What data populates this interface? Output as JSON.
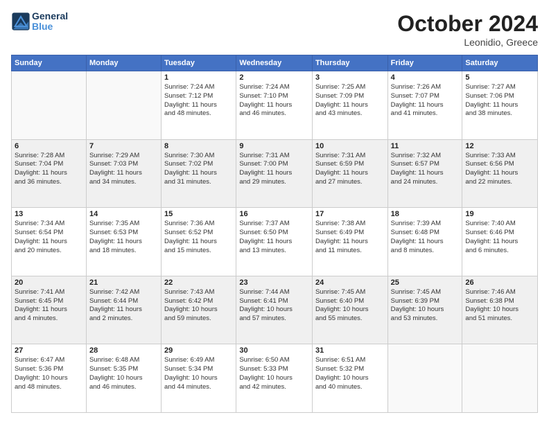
{
  "header": {
    "logo_general": "General",
    "logo_blue": "Blue",
    "month_title": "October 2024",
    "location": "Leonidio, Greece"
  },
  "days_of_week": [
    "Sunday",
    "Monday",
    "Tuesday",
    "Wednesday",
    "Thursday",
    "Friday",
    "Saturday"
  ],
  "weeks": [
    [
      {
        "day": "",
        "info": ""
      },
      {
        "day": "",
        "info": ""
      },
      {
        "day": "1",
        "info": "Sunrise: 7:24 AM\nSunset: 7:12 PM\nDaylight: 11 hours\nand 48 minutes."
      },
      {
        "day": "2",
        "info": "Sunrise: 7:24 AM\nSunset: 7:10 PM\nDaylight: 11 hours\nand 46 minutes."
      },
      {
        "day": "3",
        "info": "Sunrise: 7:25 AM\nSunset: 7:09 PM\nDaylight: 11 hours\nand 43 minutes."
      },
      {
        "day": "4",
        "info": "Sunrise: 7:26 AM\nSunset: 7:07 PM\nDaylight: 11 hours\nand 41 minutes."
      },
      {
        "day": "5",
        "info": "Sunrise: 7:27 AM\nSunset: 7:06 PM\nDaylight: 11 hours\nand 38 minutes."
      }
    ],
    [
      {
        "day": "6",
        "info": "Sunrise: 7:28 AM\nSunset: 7:04 PM\nDaylight: 11 hours\nand 36 minutes."
      },
      {
        "day": "7",
        "info": "Sunrise: 7:29 AM\nSunset: 7:03 PM\nDaylight: 11 hours\nand 34 minutes."
      },
      {
        "day": "8",
        "info": "Sunrise: 7:30 AM\nSunset: 7:02 PM\nDaylight: 11 hours\nand 31 minutes."
      },
      {
        "day": "9",
        "info": "Sunrise: 7:31 AM\nSunset: 7:00 PM\nDaylight: 11 hours\nand 29 minutes."
      },
      {
        "day": "10",
        "info": "Sunrise: 7:31 AM\nSunset: 6:59 PM\nDaylight: 11 hours\nand 27 minutes."
      },
      {
        "day": "11",
        "info": "Sunrise: 7:32 AM\nSunset: 6:57 PM\nDaylight: 11 hours\nand 24 minutes."
      },
      {
        "day": "12",
        "info": "Sunrise: 7:33 AM\nSunset: 6:56 PM\nDaylight: 11 hours\nand 22 minutes."
      }
    ],
    [
      {
        "day": "13",
        "info": "Sunrise: 7:34 AM\nSunset: 6:54 PM\nDaylight: 11 hours\nand 20 minutes."
      },
      {
        "day": "14",
        "info": "Sunrise: 7:35 AM\nSunset: 6:53 PM\nDaylight: 11 hours\nand 18 minutes."
      },
      {
        "day": "15",
        "info": "Sunrise: 7:36 AM\nSunset: 6:52 PM\nDaylight: 11 hours\nand 15 minutes."
      },
      {
        "day": "16",
        "info": "Sunrise: 7:37 AM\nSunset: 6:50 PM\nDaylight: 11 hours\nand 13 minutes."
      },
      {
        "day": "17",
        "info": "Sunrise: 7:38 AM\nSunset: 6:49 PM\nDaylight: 11 hours\nand 11 minutes."
      },
      {
        "day": "18",
        "info": "Sunrise: 7:39 AM\nSunset: 6:48 PM\nDaylight: 11 hours\nand 8 minutes."
      },
      {
        "day": "19",
        "info": "Sunrise: 7:40 AM\nSunset: 6:46 PM\nDaylight: 11 hours\nand 6 minutes."
      }
    ],
    [
      {
        "day": "20",
        "info": "Sunrise: 7:41 AM\nSunset: 6:45 PM\nDaylight: 11 hours\nand 4 minutes."
      },
      {
        "day": "21",
        "info": "Sunrise: 7:42 AM\nSunset: 6:44 PM\nDaylight: 11 hours\nand 2 minutes."
      },
      {
        "day": "22",
        "info": "Sunrise: 7:43 AM\nSunset: 6:42 PM\nDaylight: 10 hours\nand 59 minutes."
      },
      {
        "day": "23",
        "info": "Sunrise: 7:44 AM\nSunset: 6:41 PM\nDaylight: 10 hours\nand 57 minutes."
      },
      {
        "day": "24",
        "info": "Sunrise: 7:45 AM\nSunset: 6:40 PM\nDaylight: 10 hours\nand 55 minutes."
      },
      {
        "day": "25",
        "info": "Sunrise: 7:45 AM\nSunset: 6:39 PM\nDaylight: 10 hours\nand 53 minutes."
      },
      {
        "day": "26",
        "info": "Sunrise: 7:46 AM\nSunset: 6:38 PM\nDaylight: 10 hours\nand 51 minutes."
      }
    ],
    [
      {
        "day": "27",
        "info": "Sunrise: 6:47 AM\nSunset: 5:36 PM\nDaylight: 10 hours\nand 48 minutes."
      },
      {
        "day": "28",
        "info": "Sunrise: 6:48 AM\nSunset: 5:35 PM\nDaylight: 10 hours\nand 46 minutes."
      },
      {
        "day": "29",
        "info": "Sunrise: 6:49 AM\nSunset: 5:34 PM\nDaylight: 10 hours\nand 44 minutes."
      },
      {
        "day": "30",
        "info": "Sunrise: 6:50 AM\nSunset: 5:33 PM\nDaylight: 10 hours\nand 42 minutes."
      },
      {
        "day": "31",
        "info": "Sunrise: 6:51 AM\nSunset: 5:32 PM\nDaylight: 10 hours\nand 40 minutes."
      },
      {
        "day": "",
        "info": ""
      },
      {
        "day": "",
        "info": ""
      }
    ]
  ]
}
